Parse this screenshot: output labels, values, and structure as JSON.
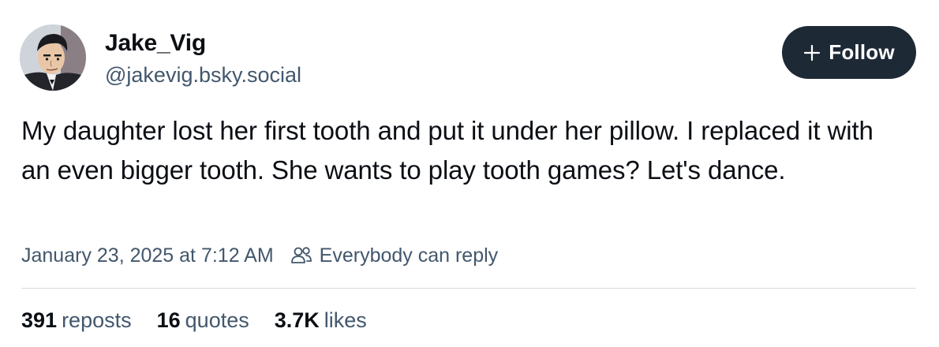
{
  "author": {
    "display_name": "Jake_Vig",
    "handle": "@jakevig.bsky.social",
    "avatar_icon": "cartoon-avatar"
  },
  "follow_button": {
    "label": "Follow",
    "icon": "plus-icon",
    "background": "#1e2936"
  },
  "post": {
    "text": "My daughter lost her first tooth and put it under her pillow. I replaced it with an even bigger tooth. She wants to play tooth games? Let's dance.",
    "timestamp": "January 23, 2025 at 7:12 AM",
    "reply_setting": "Everybody can reply",
    "reply_icon": "people-icon"
  },
  "stats": {
    "reposts_count": "391",
    "reposts_label": "reposts",
    "quotes_count": "16",
    "quotes_label": "quotes",
    "likes_count": "3.7K",
    "likes_label": "likes"
  },
  "colors": {
    "text_primary": "#0b0f14",
    "text_secondary": "#42576c",
    "divider": "#d4dbe2"
  }
}
